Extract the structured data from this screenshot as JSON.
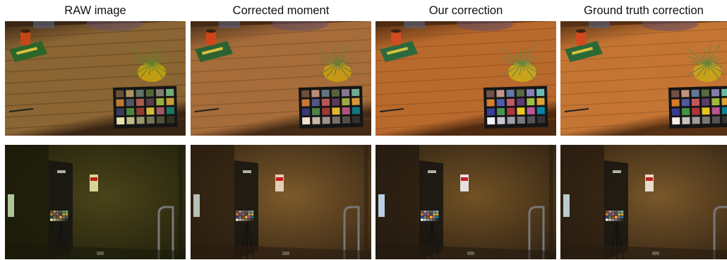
{
  "columns": [
    {
      "title": "RAW image",
      "tone": "raw"
    },
    {
      "title": "Corrected moment",
      "tone": "moment"
    },
    {
      "title": "Our correction",
      "tone": "ours"
    },
    {
      "title": "Ground truth correction",
      "tone": "gt"
    }
  ],
  "rows": [
    {
      "scene": "wooden-table-with-color-checker"
    },
    {
      "scene": "doorway-wall-with-color-checker"
    }
  ],
  "tones": {
    "raw": {
      "table_top": "#8b6533",
      "table_dark": "#3a2614",
      "table_grain": "#5e4020",
      "wall": "#4a4419",
      "wall_dark": "#1b1a0a",
      "checker_sat": 0.75
    },
    "moment": {
      "table_top": "#a66c3a",
      "table_dark": "#452a16",
      "table_grain": "#7a4e27",
      "wall": "#7d5a2b",
      "wall_dark": "#2a1d10",
      "checker_sat": 0.85
    },
    "ours": {
      "table_top": "#b8692c",
      "table_dark": "#4d2a10",
      "table_grain": "#8c4d1f",
      "wall": "#725124",
      "wall_dark": "#231a10",
      "checker_sat": 1.0
    },
    "gt": {
      "table_top": "#c47533",
      "table_dark": "#553014",
      "table_grain": "#955725",
      "wall": "#79572a",
      "wall_dark": "#281c10",
      "checker_sat": 1.0
    }
  }
}
